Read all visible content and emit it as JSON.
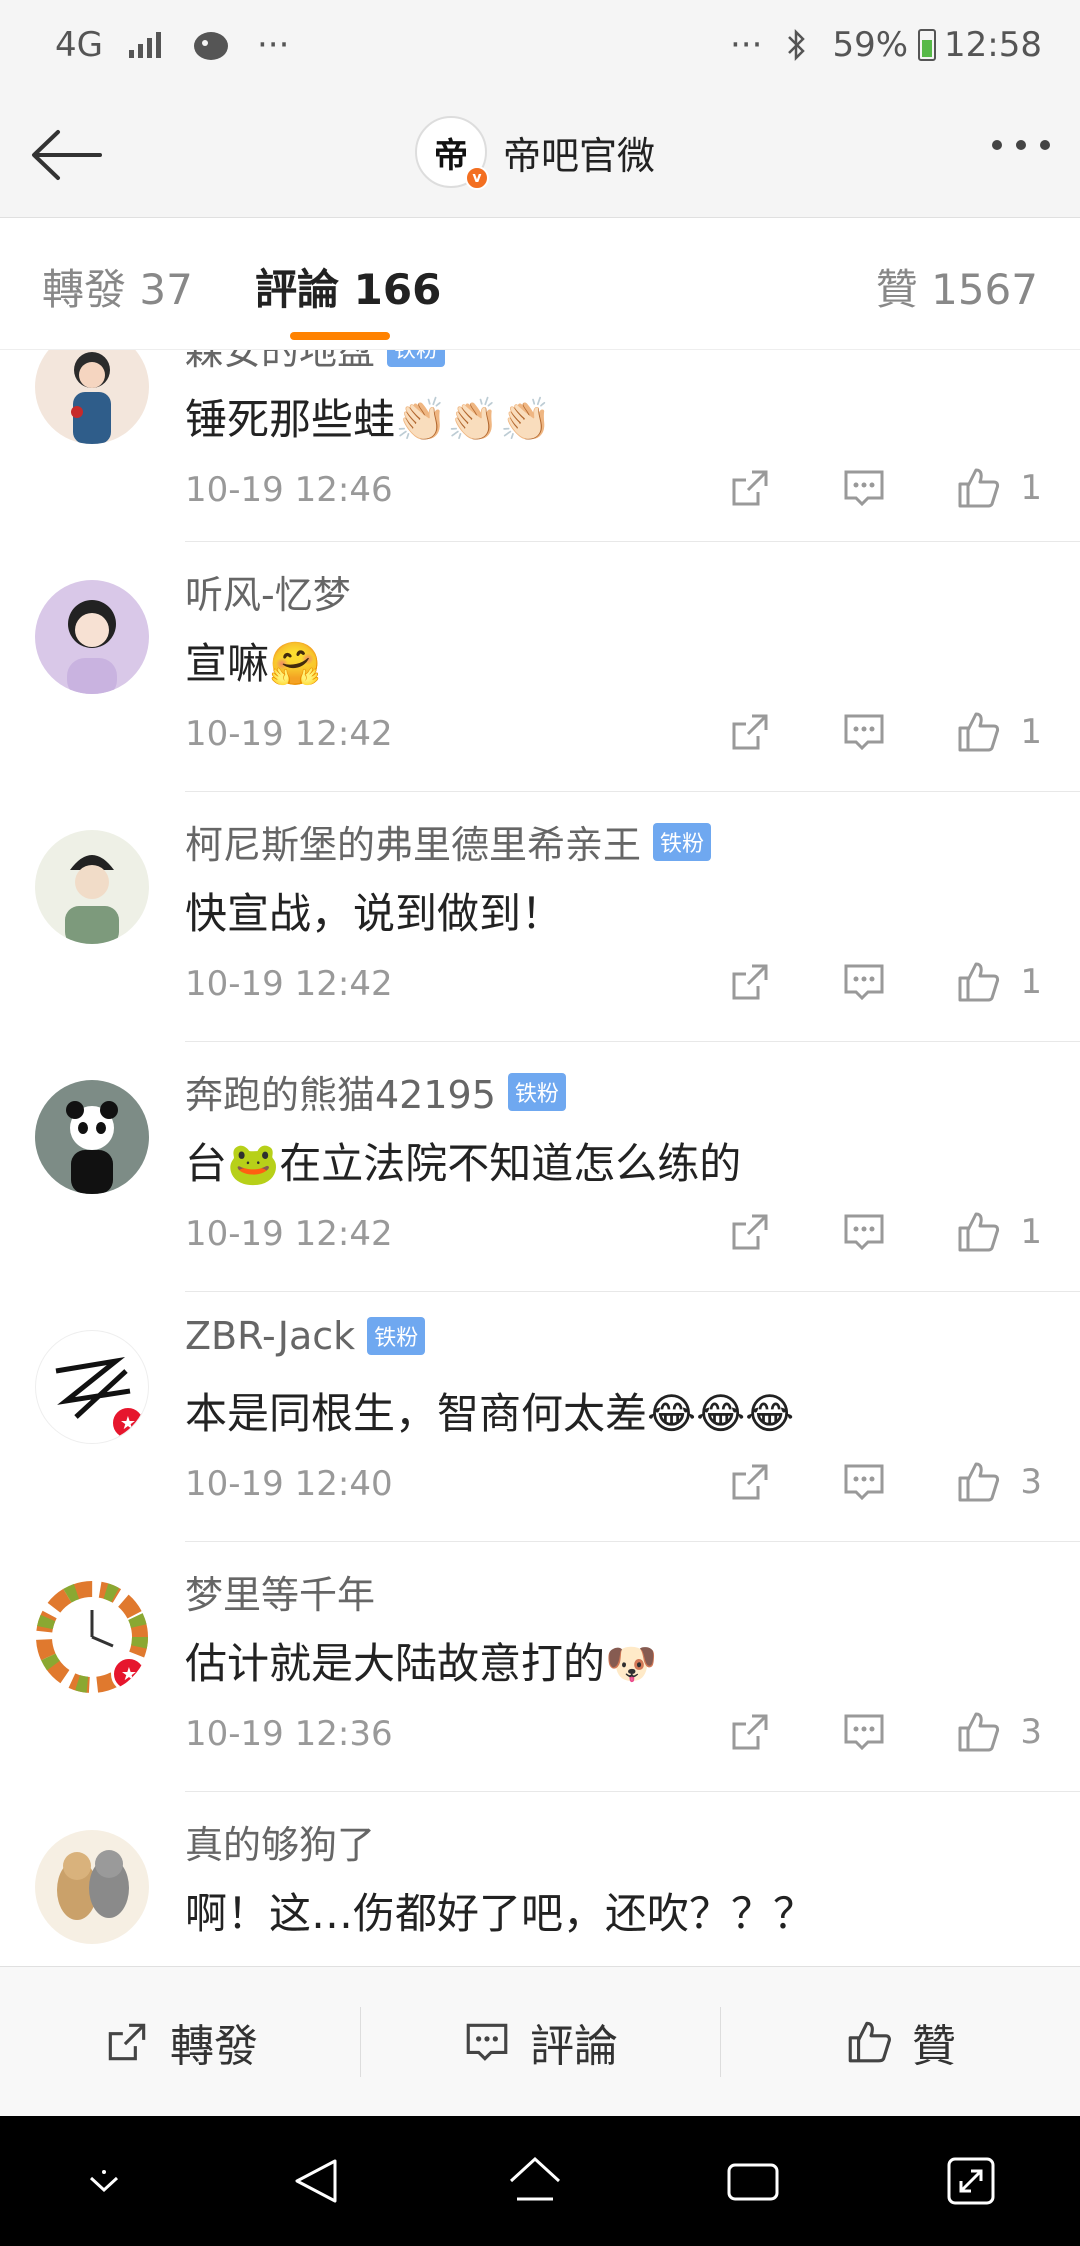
{
  "status_bar": {
    "network": "4G",
    "dots": "···",
    "right_dots": "···",
    "battery_percent": "59%",
    "battery_level": 0.59,
    "time": "12:58"
  },
  "header": {
    "avatar_char": "帝",
    "title": "帝吧官微"
  },
  "tabs": {
    "repost": "轉發 37",
    "comments": "評論 166",
    "likes": "贊 1567"
  },
  "comments": [
    {
      "username": "森安的地盘",
      "badge": "",
      "content": "锤死那些蛙👏🏻👏🏻👏🏻",
      "time": "10-19 12:46",
      "likes": "1",
      "vip": false
    },
    {
      "username": "听风-忆梦",
      "badge": "",
      "content": "宣嘛🤗",
      "time": "10-19 12:42",
      "likes": "1",
      "vip": false
    },
    {
      "username": "柯尼斯堡的弗里德里希亲王",
      "badge": "铁粉",
      "content": "快宣战，说到做到！",
      "time": "10-19 12:42",
      "likes": "1",
      "vip": false
    },
    {
      "username": "奔跑的熊猫42195",
      "badge": "铁粉",
      "content": "台🐸在立法院不知道怎么练的",
      "time": "10-19 12:42",
      "likes": "1",
      "vip": false
    },
    {
      "username": "ZBR-Jack",
      "badge": "铁粉",
      "content": "本是同根生，智商何太差😂😂😂",
      "time": "10-19 12:40",
      "likes": "3",
      "vip": true
    },
    {
      "username": "梦里等千年",
      "badge": "",
      "content": "估计就是大陆故意打的🐶",
      "time": "10-19 12:36",
      "likes": "3",
      "vip": true
    },
    {
      "username": "真的够狗了",
      "badge": "",
      "content": "啊！这…伤都好了吧，还吹？？？",
      "time": "",
      "likes": "",
      "vip": false
    }
  ],
  "bottom_bar": {
    "repost": "轉發",
    "comment": "評論",
    "like": "贊"
  },
  "colors": {
    "accent": "#ff8200",
    "badge": "#6fa8f0",
    "vip": "#e6162d"
  }
}
